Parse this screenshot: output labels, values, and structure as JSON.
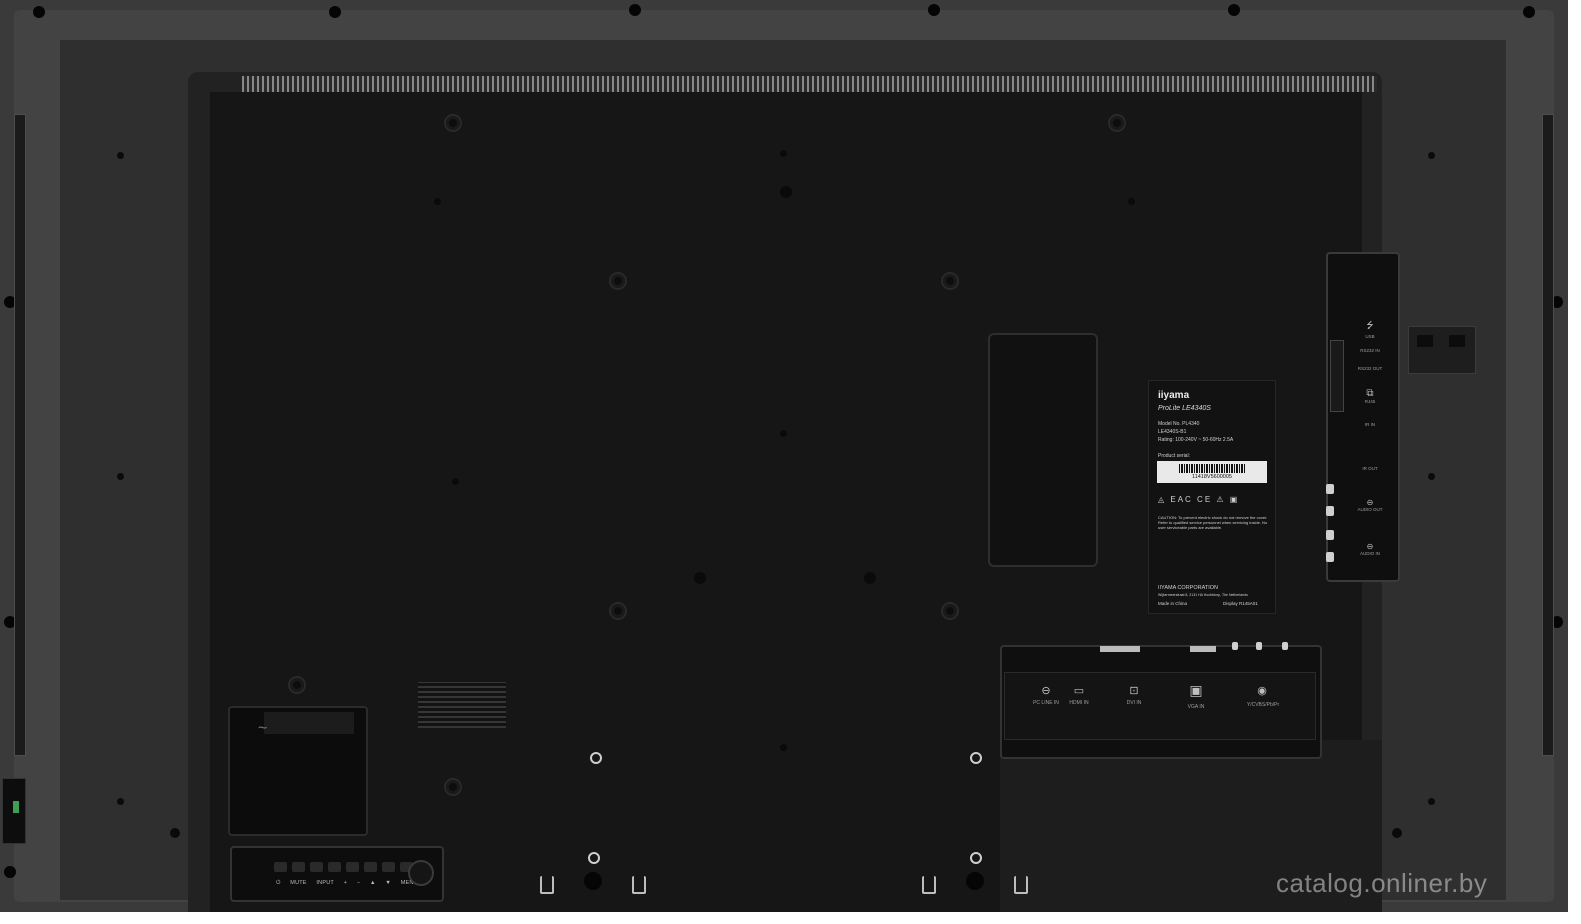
{
  "label": {
    "brand": "iiyama",
    "product": "ProLite LE4340S",
    "model_line": "Model No. PL4340",
    "model_code": "LE4340S-B1",
    "rating": "Rating: 100-240V ~ 50-60Hz  2.5A",
    "serial_title": "Product serial:",
    "serial": "11418V5600005",
    "cert_marks": "◬ EAC CE ⚠ ▣",
    "caution": "CAUTION: To prevent electric shock do not remove the cover. Refer to qualified service personnel when servicing inside. No user serviceable parts are available.",
    "corporation": "IIYAMA CORPORATION",
    "address": "Wijkermeerstraat 8, 2131 HA Hoofddorp, The Netherlands",
    "made_in": "Made in China",
    "display_code": "Display   R145A01"
  },
  "buttons": {
    "labels": [
      "⏻",
      "MUTE",
      "INPUT",
      "+",
      "−",
      "▲",
      "▼",
      "MENU"
    ]
  },
  "bottom_ports": [
    {
      "icon": "⊖",
      "label": "PC LINE IN",
      "name": "pc-line-in"
    },
    {
      "icon": "▭",
      "label": "HDMI IN",
      "name": "hdmi-in"
    },
    {
      "icon": "⊡",
      "label": "DVI IN",
      "name": "dvi-in"
    },
    {
      "icon": "▣",
      "label": "VGA IN",
      "name": "vga-in"
    },
    {
      "icon": "◉",
      "label": "Y/CVBS/Pb/Pr",
      "name": "component-in"
    }
  ],
  "side_ports": [
    {
      "icon": "⭍",
      "label": "USB",
      "name": "usb"
    },
    {
      "icon": "",
      "label": "RS232 IN",
      "name": "rs232-in"
    },
    {
      "icon": "",
      "label": "RS232 OUT",
      "name": "rs232-out"
    },
    {
      "icon": "⧉",
      "label": "RJ45",
      "name": "rj45"
    },
    {
      "icon": "",
      "label": "IR IN",
      "name": "ir-in"
    },
    {
      "icon": "",
      "label": "IR OUT",
      "name": "ir-out"
    },
    {
      "icon": "⊖",
      "label": "AUDIO OUT",
      "name": "audio-out"
    },
    {
      "icon": "⊖",
      "label": "AUDIO IN",
      "name": "audio-in"
    }
  ],
  "power_symbol": "~",
  "watermark": "catalog.onliner.by"
}
